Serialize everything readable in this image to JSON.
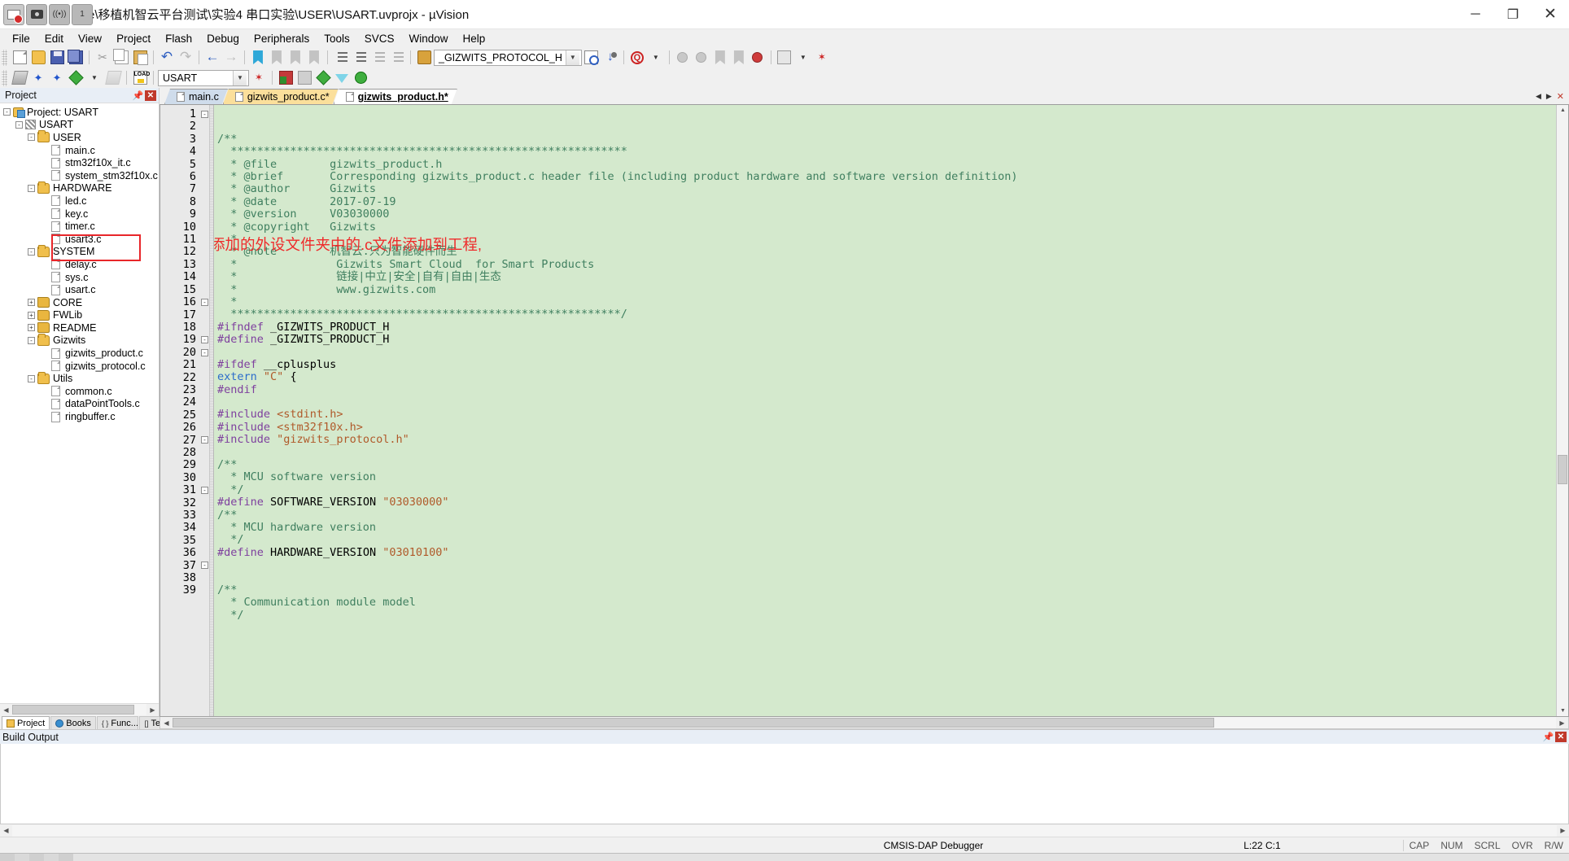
{
  "window": {
    "title": "e\\移植机智云平台测试\\实验4 串口实验\\USER\\USART.uvprojx - µVision",
    "minimize": "─",
    "maximize": "❐",
    "close": "✕",
    "overlay_icons": [
      "screen-record-icon",
      "camera-icon",
      "wifi-icon",
      "counter-1-icon"
    ]
  },
  "menu": {
    "items": [
      "File",
      "Edit",
      "View",
      "Project",
      "Flash",
      "Debug",
      "Peripherals",
      "Tools",
      "SVCS",
      "Window",
      "Help"
    ]
  },
  "toolbar1": {
    "buttons": [
      "new-file-icon",
      "open-file-icon",
      "save-icon",
      "save-all-icon",
      "cut-icon",
      "copy-icon",
      "paste-icon",
      "undo-icon",
      "redo-icon",
      "navigate-back-icon",
      "navigate-forward-icon",
      "bookmark-toggle-icon",
      "bookmark-prev-icon",
      "bookmark-next-icon",
      "bookmark-clear-icon",
      "indent-increase-icon",
      "indent-decrease-icon",
      "comment-icon",
      "uncomment-icon",
      "browse-icon"
    ],
    "search_value": "_GIZWITS_PROTOCOL_H",
    "search_placeholder": "",
    "after_search_icons": [
      "find-in-files-icon",
      "insert-bookmark-icon",
      "zoom-find-icon",
      "debug-dot-icon"
    ]
  },
  "toolbar2": {
    "buttons": [
      "build-icon",
      "rebuild-icon",
      "batch-build-icon",
      "translate-icon",
      "stop-build-icon",
      "load-icon"
    ],
    "target_value": "USART",
    "right_icons": [
      "target-options-icon",
      "configuration-wizard-icon",
      "manage-components-icon",
      "multi-project-icon",
      "pack-installer-icon",
      "filter-icon",
      "pack-browser-icon"
    ]
  },
  "project_panel": {
    "title": "Project",
    "pin_icon": "pin-icon",
    "close_icon": "close-icon",
    "tree": [
      {
        "depth": 0,
        "label": "Project: USART",
        "icon": "project-icon",
        "expander": "-"
      },
      {
        "depth": 1,
        "label": "USART",
        "icon": "target-icon",
        "expander": "-"
      },
      {
        "depth": 2,
        "label": "USER",
        "icon": "folder-open-icon",
        "expander": "-"
      },
      {
        "depth": 3,
        "label": "main.c",
        "icon": "c-file-icon",
        "expander": ""
      },
      {
        "depth": 3,
        "label": "stm32f10x_it.c",
        "icon": "c-file-icon",
        "expander": ""
      },
      {
        "depth": 3,
        "label": "system_stm32f10x.c",
        "icon": "c-file-icon",
        "expander": ""
      },
      {
        "depth": 2,
        "label": "HARDWARE",
        "icon": "folder-open-icon",
        "expander": "-"
      },
      {
        "depth": 3,
        "label": "led.c",
        "icon": "c-file-icon",
        "expander": ""
      },
      {
        "depth": 3,
        "label": "key.c",
        "icon": "c-file-icon",
        "expander": ""
      },
      {
        "depth": 3,
        "label": "timer.c",
        "icon": "c-file-icon",
        "expander": ""
      },
      {
        "depth": 3,
        "label": "usart3.c",
        "icon": "c-file-icon",
        "expander": ""
      },
      {
        "depth": 2,
        "label": "SYSTEM",
        "icon": "folder-open-icon",
        "expander": "-"
      },
      {
        "depth": 3,
        "label": "delay.c",
        "icon": "c-file-icon",
        "expander": ""
      },
      {
        "depth": 3,
        "label": "sys.c",
        "icon": "c-file-icon",
        "expander": ""
      },
      {
        "depth": 3,
        "label": "usart.c",
        "icon": "c-file-icon",
        "expander": ""
      },
      {
        "depth": 2,
        "label": "CORE",
        "icon": "folder-closed-icon",
        "expander": "+"
      },
      {
        "depth": 2,
        "label": "FWLib",
        "icon": "folder-closed-icon",
        "expander": "+"
      },
      {
        "depth": 2,
        "label": "README",
        "icon": "folder-closed-icon",
        "expander": "+"
      },
      {
        "depth": 2,
        "label": "Gizwits",
        "icon": "folder-open-icon",
        "expander": "-"
      },
      {
        "depth": 3,
        "label": "gizwits_product.c",
        "icon": "c-file-icon",
        "expander": ""
      },
      {
        "depth": 3,
        "label": "gizwits_protocol.c",
        "icon": "c-file-icon",
        "expander": ""
      },
      {
        "depth": 2,
        "label": "Utils",
        "icon": "folder-open-icon",
        "expander": "-"
      },
      {
        "depth": 3,
        "label": "common.c",
        "icon": "c-file-icon",
        "expander": ""
      },
      {
        "depth": 3,
        "label": "dataPointTools.c",
        "icon": "c-file-icon",
        "expander": ""
      },
      {
        "depth": 3,
        "label": "ringbuffer.c",
        "icon": "c-file-icon",
        "expander": ""
      }
    ],
    "tabs": [
      {
        "label": "Project",
        "icon": "project-icon",
        "active": true
      },
      {
        "label": "Books",
        "icon": "books-icon",
        "active": false
      },
      {
        "label": "Func...",
        "icon": "functions-icon",
        "active": false
      },
      {
        "label": "Temp...",
        "icon": "templates-icon",
        "active": false
      }
    ]
  },
  "editor": {
    "tabs": [
      {
        "label": "main.c",
        "state": "inactive-blue"
      },
      {
        "label": "gizwits_product.c*",
        "state": "inactive-yellow"
      },
      {
        "label": "gizwits_product.h*",
        "state": "active"
      }
    ],
    "nav_left": "◀",
    "nav_right": "▶",
    "close_tab": "✕",
    "lines": [
      {
        "n": 1,
        "fold": "-",
        "text": "/**"
      },
      {
        "n": 2,
        "fold": "",
        "text": "  ************************************************************"
      },
      {
        "n": 3,
        "fold": "",
        "text": "  * @file        gizwits_product.h"
      },
      {
        "n": 4,
        "fold": "",
        "text": "  * @brief       Corresponding gizwits_product.c header file (including product hardware and software version definition)"
      },
      {
        "n": 5,
        "fold": "",
        "text": "  * @author      Gizwits"
      },
      {
        "n": 6,
        "fold": "",
        "text": "  * @date        2017-07-19"
      },
      {
        "n": 7,
        "fold": "",
        "text": "  * @version     V03030000"
      },
      {
        "n": 8,
        "fold": "",
        "text": "  * @copyright   Gizwits"
      },
      {
        "n": 9,
        "fold": "",
        "text": "  *"
      },
      {
        "n": 10,
        "fold": "",
        "text": "  * @note        机智云.只为智能硬件而生"
      },
      {
        "n": 11,
        "fold": "",
        "text": "  *               Gizwits Smart Cloud  for Smart Products"
      },
      {
        "n": 12,
        "fold": "",
        "text": "  *               链接|中立|安全|自有|自由|生态"
      },
      {
        "n": 13,
        "fold": "",
        "text": "  *               www.gizwits.com"
      },
      {
        "n": 14,
        "fold": "",
        "text": "  *"
      },
      {
        "n": 15,
        "fold": "",
        "text": "  ***********************************************************/"
      },
      {
        "n": 16,
        "fold": "-",
        "text": "#ifndef _GIZWITS_PRODUCT_H"
      },
      {
        "n": 17,
        "fold": "",
        "text": "#define _GIZWITS_PRODUCT_H"
      },
      {
        "n": 18,
        "fold": "",
        "text": ""
      },
      {
        "n": 19,
        "fold": "-",
        "text": "#ifdef __cplusplus"
      },
      {
        "n": 20,
        "fold": "-",
        "text": "extern \"C\" {"
      },
      {
        "n": 21,
        "fold": "",
        "text": "#endif"
      },
      {
        "n": 22,
        "fold": "",
        "text": ""
      },
      {
        "n": 23,
        "fold": "",
        "text": "#include <stdint.h>"
      },
      {
        "n": 24,
        "fold": "",
        "text": "#include <stm32f10x.h>"
      },
      {
        "n": 25,
        "fold": "",
        "text": "#include \"gizwits_protocol.h\""
      },
      {
        "n": 26,
        "fold": "",
        "text": ""
      },
      {
        "n": 27,
        "fold": "-",
        "text": "/**"
      },
      {
        "n": 28,
        "fold": "",
        "text": "  * MCU software version"
      },
      {
        "n": 29,
        "fold": "",
        "text": "  */"
      },
      {
        "n": 30,
        "fold": "",
        "text": "#define SOFTWARE_VERSION \"03030000\""
      },
      {
        "n": 31,
        "fold": "-",
        "text": "/**"
      },
      {
        "n": 32,
        "fold": "",
        "text": "  * MCU hardware version"
      },
      {
        "n": 33,
        "fold": "",
        "text": "  */"
      },
      {
        "n": 34,
        "fold": "",
        "text": "#define HARDWARE_VERSION \"03010100\""
      },
      {
        "n": 35,
        "fold": "",
        "text": ""
      },
      {
        "n": 36,
        "fold": "",
        "text": ""
      },
      {
        "n": 37,
        "fold": "-",
        "text": "/**"
      },
      {
        "n": 38,
        "fold": "",
        "text": "  * Communication module model"
      },
      {
        "n": 39,
        "fold": "",
        "text": "  */"
      }
    ]
  },
  "annotation": {
    "text": "将刚添加的外设文件夹中的.c文件添加到工程,",
    "color": "#ef2b2b"
  },
  "build_output": {
    "title": "Build Output",
    "pin_icon": "pin-icon",
    "close_icon": "close-icon",
    "content": ""
  },
  "statusbar": {
    "debugger": "CMSIS-DAP Debugger",
    "position": "L:22 C:1",
    "flags": [
      "CAP",
      "NUM",
      "SCRL",
      "OVR",
      "R/W"
    ]
  }
}
